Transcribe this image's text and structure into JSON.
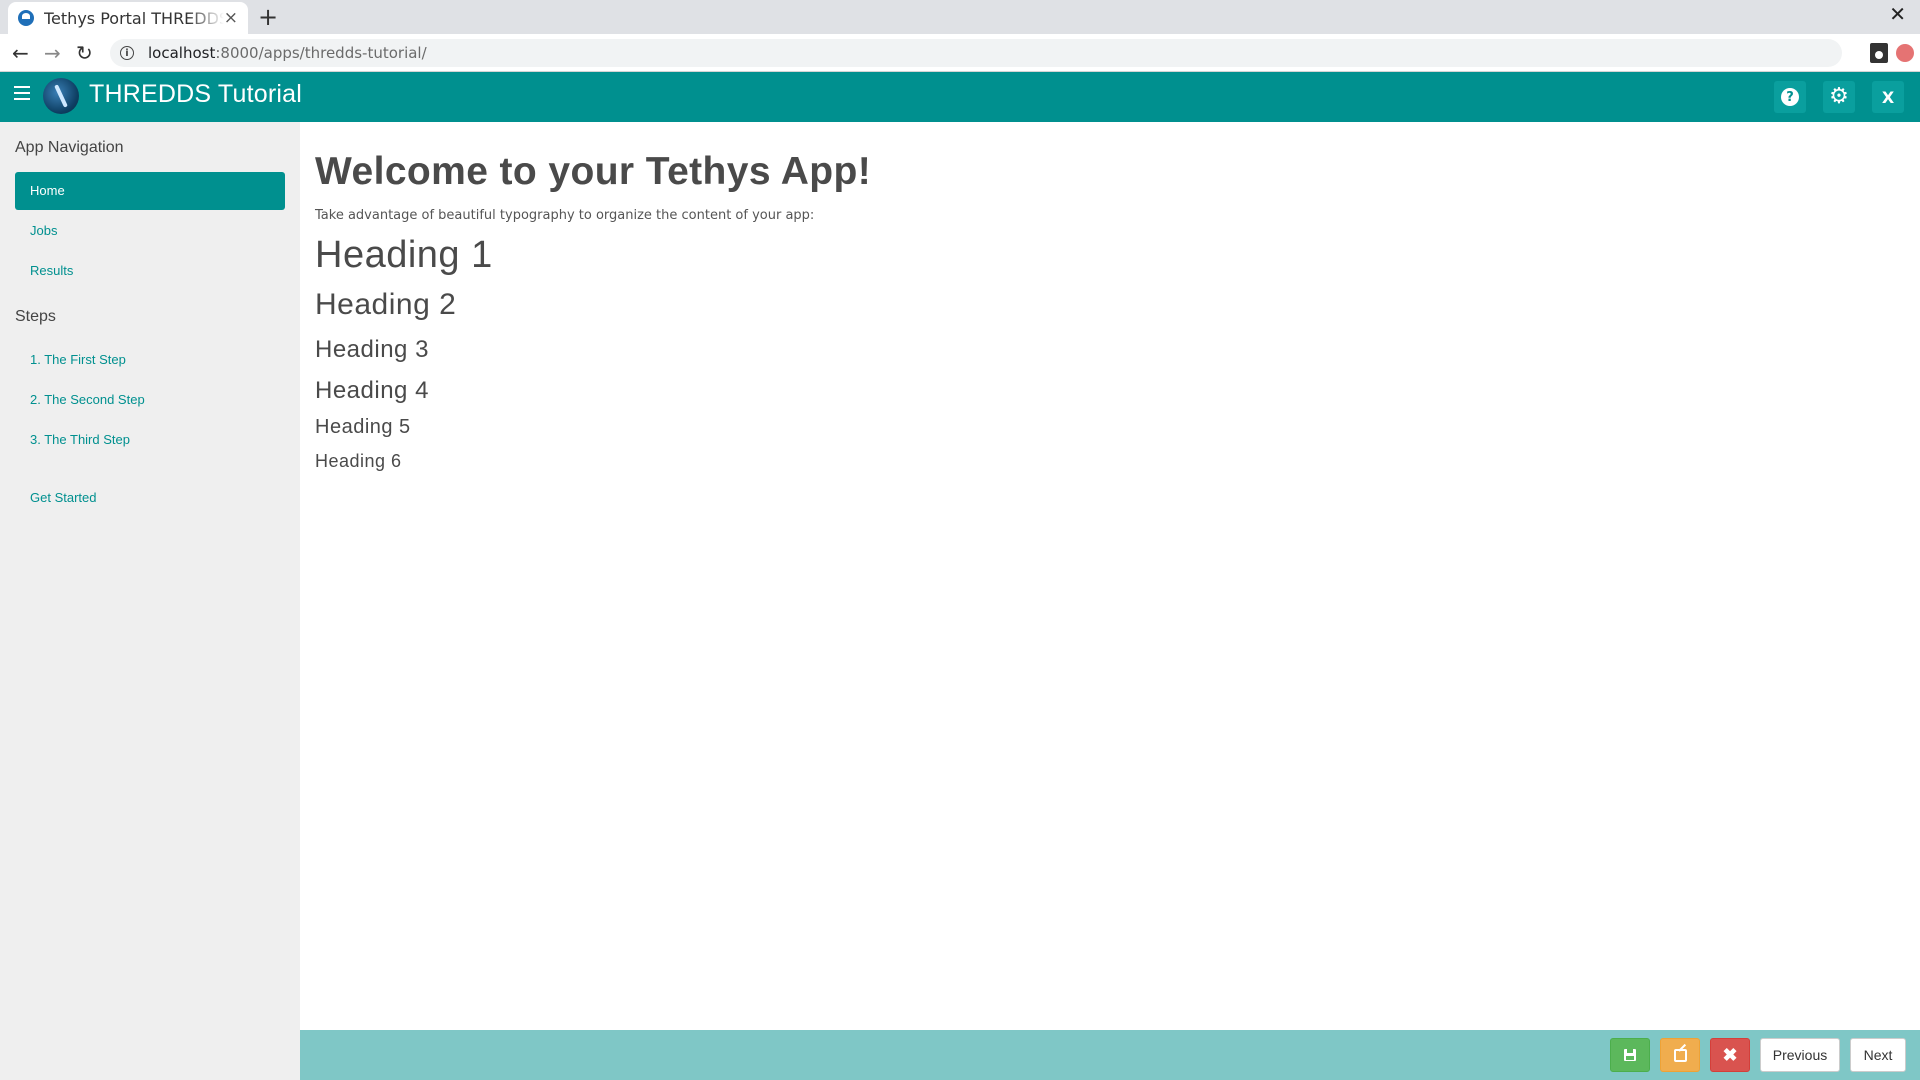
{
  "browser": {
    "tab_title": "Tethys Portal THREDDS Tutorial",
    "tab_close": "×",
    "new_tab": "+",
    "window_close": "✕",
    "url_host": "localhost",
    "url_path": ":8000/apps/thredds-tutorial/"
  },
  "header": {
    "title": "THREDDS Tutorial",
    "help_icon": "?",
    "settings_icon": "⚙",
    "exit_label": "X",
    "color": "#00908f"
  },
  "sidebar": {
    "nav_heading": "App Navigation",
    "nav_items": [
      {
        "label": "Home",
        "active": true
      },
      {
        "label": "Jobs",
        "active": false
      },
      {
        "label": "Results",
        "active": false
      }
    ],
    "steps_heading": "Steps",
    "steps": [
      {
        "label": "1. The First Step"
      },
      {
        "label": "2. The Second Step"
      },
      {
        "label": "3. The Third Step"
      }
    ],
    "get_started": "Get Started"
  },
  "main": {
    "welcome": "Welcome to your Tethys App!",
    "intro": "Take advantage of beautiful typography to organize the content of your app:",
    "headings": [
      "Heading 1",
      "Heading 2",
      "Heading 3",
      "Heading 4",
      "Heading 5",
      "Heading 6"
    ]
  },
  "footer": {
    "delete_icon": "✖",
    "previous_label": "Previous",
    "next_label": "Next",
    "save_color": "#5cb85c",
    "edit_color": "#f0ad4e",
    "delete_color": "#d9534f"
  }
}
